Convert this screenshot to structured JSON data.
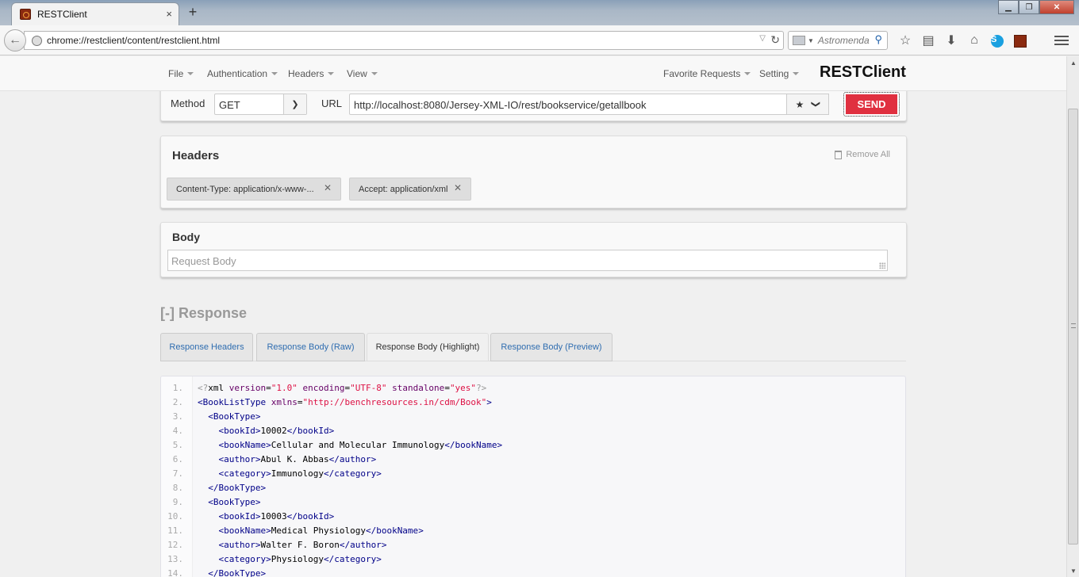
{
  "browser": {
    "tab_title": "RESTClient",
    "tab_close": "×",
    "new_tab": "+",
    "window_buttons": {
      "minimize": "▁",
      "maximize": "❐",
      "close": "✕"
    },
    "address": "chrome://restclient/content/restclient.html",
    "search_placeholder": "Astromenda",
    "icons": [
      "bookmark-star-icon",
      "reading-list-icon",
      "downloads-icon",
      "home-icon",
      "skype-icon",
      "restclient-addon-icon",
      "menu-icon"
    ]
  },
  "app": {
    "nav_left": [
      "File",
      "Authentication",
      "Headers",
      "View"
    ],
    "nav_right": [
      "Favorite Requests",
      "Setting"
    ],
    "brand": "RESTClient"
  },
  "request": {
    "method_label": "Method",
    "method_value": "GET",
    "url_label": "URL",
    "url_value": "http://localhost:8080/Jersey-XML-IO/rest/bookservice/getallbook",
    "send_label": "SEND"
  },
  "headers": {
    "title": "Headers",
    "remove_all": "Remove All",
    "items": [
      "Content-Type: application/x-www-...",
      "Accept: application/xml"
    ]
  },
  "body": {
    "title": "Body",
    "placeholder": "Request Body"
  },
  "response": {
    "title": "[-] Response",
    "tabs": [
      "Response Headers",
      "Response Body (Raw)",
      "Response Body (Highlight)",
      "Response Body (Preview)"
    ],
    "active_tab": "Response Body (Highlight)",
    "lines": [
      "<?xml version=\"1.0\" encoding=\"UTF-8\" standalone=\"yes\"?>",
      "<BookListType xmlns=\"http://benchresources.in/cdm/Book\">",
      "  <BookType>",
      "    <bookId>10002</bookId>",
      "    <bookName>Cellular and Molecular Immunology</bookName>",
      "    <author>Abul K. Abbas</author>",
      "    <category>Immunology</category>",
      "  </BookType>",
      "  <BookType>",
      "    <bookId>10003</bookId>",
      "    <bookName>Medical Physiology</bookName>",
      "    <author>Walter F. Boron</author>",
      "    <category>Physiology</category>",
      "  </BookType>"
    ]
  }
}
